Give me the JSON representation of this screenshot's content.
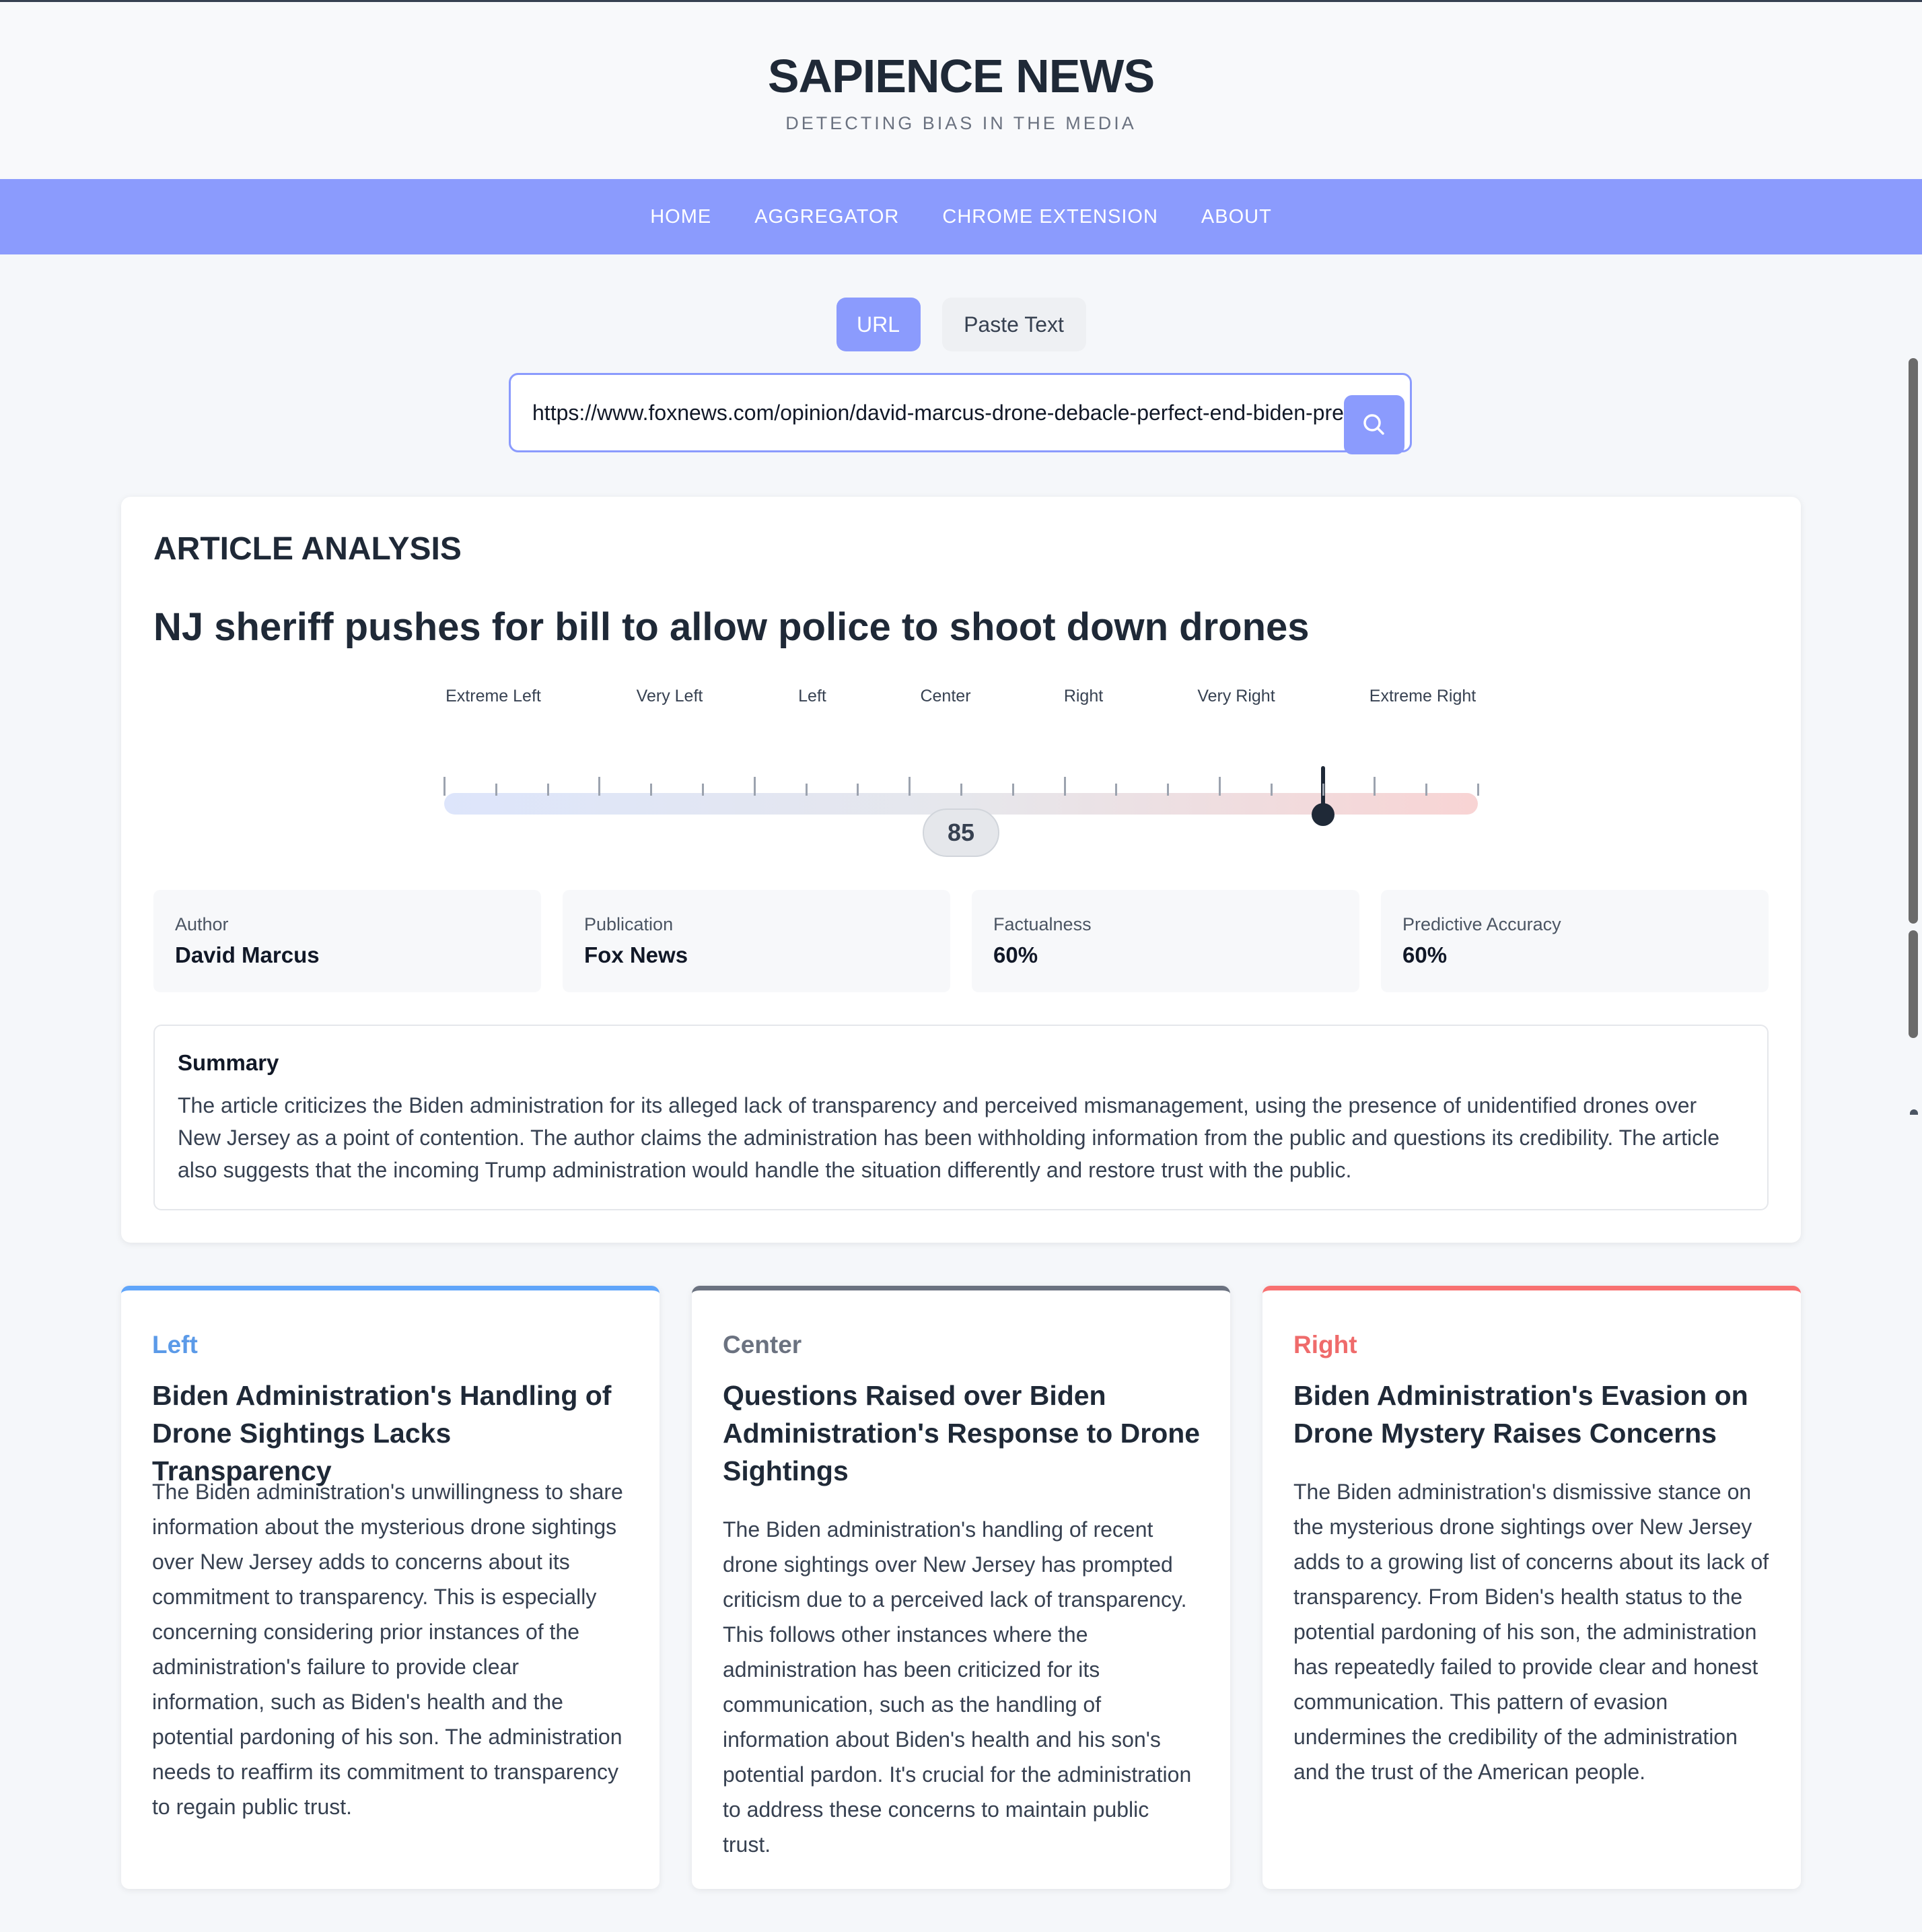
{
  "site": {
    "title": "SAPIENCE NEWS",
    "tagline": "DETECTING BIAS IN THE MEDIA"
  },
  "nav": {
    "items": [
      {
        "label": "HOME"
      },
      {
        "label": "AGGREGATOR"
      },
      {
        "label": "CHROME EXTENSION"
      },
      {
        "label": "ABOUT"
      }
    ]
  },
  "input_modes": {
    "url_label": "URL",
    "paste_label": "Paste Text",
    "selected": "URL"
  },
  "url_input": {
    "value": "https://www.foxnews.com/opinion/david-marcus-drone-debacle-perfect-end-biden-presidency",
    "search_icon": "search-icon"
  },
  "analysis": {
    "heading": "ARTICLE ANALYSIS",
    "article_title": "NJ sheriff pushes for bill to allow police to shoot down drones",
    "bias_scale": {
      "labels": [
        "Extreme Left",
        "Very Left",
        "Left",
        "Center",
        "Right",
        "Very Right",
        "Extreme Right"
      ],
      "score": "85",
      "score_fraction": 0.85
    },
    "stats": [
      {
        "label": "Author",
        "value": "David Marcus"
      },
      {
        "label": "Publication",
        "value": "Fox News"
      },
      {
        "label": "Factualness",
        "value": "60%"
      },
      {
        "label": "Predictive Accuracy",
        "value": "60%"
      }
    ],
    "summary": {
      "title": "Summary",
      "text": "The article criticizes the Biden administration for its alleged lack of transparency and perceived mismanagement, using the presence of unidentified drones over New Jersey as a point of contention. The author claims the administration has been withholding information from the public and questions its credibility. The article also suggests that the incoming Trump administration would handle the situation differently and restore trust with the public."
    }
  },
  "perspectives": [
    {
      "label": "Left",
      "headline": "Biden Administration's Handling of Drone Sightings Lacks Transparency",
      "body": "The Biden administration's unwillingness to share information about the mysterious drone sightings over New Jersey adds to concerns about its commitment to transparency. This is especially concerning considering prior instances of the administration's failure to provide clear information, such as Biden's health and the potential pardoning of his son. The administration needs to reaffirm its commitment to transparency to regain public trust.",
      "accent": "#60a5fa"
    },
    {
      "label": "Center",
      "headline": "Questions Raised over Biden Administration's Response to Drone Sightings",
      "body": "The Biden administration's handling of recent drone sightings over New Jersey has prompted criticism due to a perceived lack of transparency. This follows other instances where the administration has been criticized for its communication, such as the handling of information about Biden's health and his son's potential pardon. It's crucial for the administration to address these concerns to maintain public trust.",
      "accent": "#6b7280"
    },
    {
      "label": "Right",
      "headline": "Biden Administration's Evasion on Drone Mystery Raises Concerns",
      "body": "The Biden administration's dismissive stance on the mysterious drone sightings over New Jersey adds to a growing list of concerns about its lack of transparency. From Biden's health status to the potential pardoning of his son, the administration has repeatedly failed to provide clear and honest communication. This pattern of evasion undermines the credibility of the administration and the trust of the American people.",
      "accent": "#f87171"
    }
  ],
  "colors": {
    "accent": "#8b9bfd",
    "text_dark": "#1f2937",
    "background": "#f5f7fa"
  }
}
